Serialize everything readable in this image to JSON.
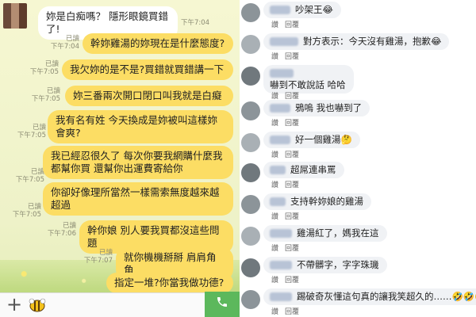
{
  "chat": {
    "messages": [
      {
        "dir": "in",
        "text": "妳是白痴嗎？ 隱形眼鏡買錯了!",
        "read": "",
        "time": "下午7:04"
      },
      {
        "dir": "out",
        "text": "幹妳雞湯的妳現在是什麼態度?",
        "read": "已讀",
        "time": "下午7:04"
      },
      {
        "dir": "out",
        "text": "我欠妳的是不是?買錯就買錯講一下",
        "read": "已讀",
        "time": "下午7:05"
      },
      {
        "dir": "out",
        "text": "妳三番兩次開口閉口叫我就是白癡",
        "read": "已讀",
        "time": "下午7:05"
      },
      {
        "dir": "out",
        "text": "我有名有姓 今天換成是妳被叫這樣妳會爽?",
        "read": "已讀",
        "time": "下午7:05"
      },
      {
        "dir": "out",
        "text": "我已經忍很久了 每次你要我網購什麼我都幫你買 還幫你出運費寄給你",
        "read": "已讀",
        "time": "下午7:05"
      },
      {
        "dir": "out",
        "text": "你卻好像理所當然一樣需索無度越來越超過",
        "read": "已讀",
        "time": "下午7:05"
      },
      {
        "dir": "out",
        "text": "幹你娘 別人要我買都沒這些問題",
        "read": "已讀",
        "time": "下午7:06"
      },
      {
        "dir": "out",
        "text": "就你機機掰掰 肩肩角角",
        "read": "已讀",
        "time": "下午7:07"
      },
      {
        "dir": "out",
        "text": "指定一堆?你當我做功德?",
        "read": "",
        "time": ""
      }
    ],
    "input": {
      "plus": "+",
      "sticker_icon": "bee-sticker-icon",
      "phone_icon": "phone-icon"
    }
  },
  "comments": {
    "like_label": "讚",
    "reply_label": "回覆",
    "items": [
      {
        "text": "吵架王😂"
      },
      {
        "text": "對方表示：今天沒有雞湯，抱歉😂"
      },
      {
        "text": "嚇到不敢說話 哈哈"
      },
      {
        "text": "鴉嗚 我也嚇到了"
      },
      {
        "text": "好一個雞湯🤔"
      },
      {
        "text": "超屌連串罵"
      },
      {
        "text": "支持幹妳娘的雞湯"
      },
      {
        "text": "雞湯紅了，媽我在這"
      },
      {
        "text": "不帶髒字，字字珠璣"
      },
      {
        "text": "踢破奇灰懂這句真的讓我笑超久的……🤣🤣🤣"
      }
    ]
  }
}
